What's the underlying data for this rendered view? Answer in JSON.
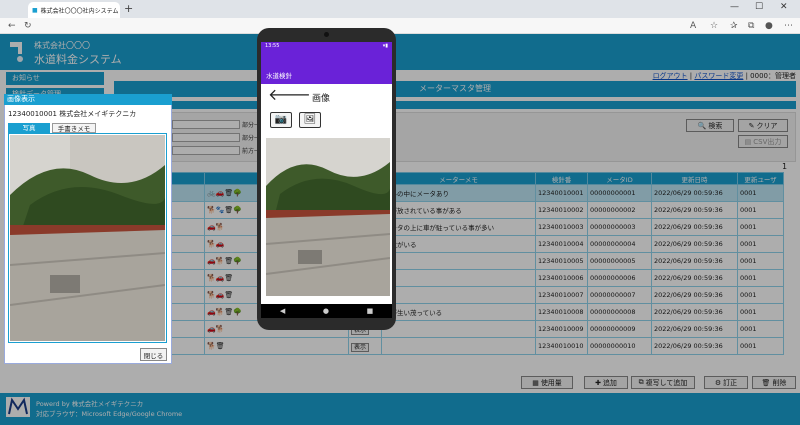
{
  "browser": {
    "tab_title": "株式会社〇〇〇社内システム / 水...",
    "new_tab": "+",
    "win_min": "—",
    "win_max": "☐",
    "win_close": "✕",
    "tab_close": "✕"
  },
  "header": {
    "company": "株式会社〇〇〇",
    "system": "水道料金システム"
  },
  "userbar": {
    "logout": "ログアウト",
    "sep": " | ",
    "change_password": "パスワード変更",
    "user": " | 0000：管理者"
  },
  "sidebar": {
    "items": [
      {
        "label": "お知らせ"
      },
      {
        "label": "検針データ管理"
      }
    ]
  },
  "page": {
    "title": "メーターマスタ管理",
    "search_label": "検索",
    "clear_label": "クリア",
    "csv_label": "CSV出力",
    "page_number": "1",
    "filters": [
      {
        "label": "部分一致"
      },
      {
        "label": "部分一致"
      },
      {
        "label": "前方一致"
      }
    ]
  },
  "table": {
    "headers": [
      "",
      "",
      "",
      "メーターメモ",
      "検針番",
      "メータID",
      "更新日時",
      "更新ユーザ"
    ],
    "rows": [
      {
        "memo": "茂みの中にメータあり",
        "kenshin": "12340010001",
        "meter": "00000000001",
        "date": "2022/06/29 00:59:36",
        "user": "0001",
        "selected": true
      },
      {
        "memo": "犬が放されている事がある",
        "kenshin": "12340010002",
        "meter": "00000000002",
        "date": "2022/06/29 00:59:36",
        "user": "0001"
      },
      {
        "memo": "メータの上に車が駐っている事が多い",
        "kenshin": "12340010003",
        "meter": "00000000003",
        "date": "2022/06/29 00:59:36",
        "user": "0001"
      },
      {
        "memo": "猛犬がいる",
        "kenshin": "12340010004",
        "meter": "00000000004",
        "date": "2022/06/29 00:59:36",
        "user": "0001"
      },
      {
        "memo": "",
        "kenshin": "12340010005",
        "meter": "00000000005",
        "date": "2022/06/29 00:59:36",
        "user": "0001"
      },
      {
        "memo": "",
        "kenshin": "12340010006",
        "meter": "00000000006",
        "date": "2022/06/29 00:59:36",
        "user": "0001"
      },
      {
        "memo": "",
        "kenshin": "12340010007",
        "meter": "00000000007",
        "date": "2022/06/29 00:59:36",
        "user": "0001"
      },
      {
        "memo": "草が生い茂っている",
        "kenshin": "12340010008",
        "meter": "00000000008",
        "date": "2022/06/29 00:59:36",
        "user": "0001"
      },
      {
        "memo": "",
        "kenshin": "12340010009",
        "meter": "00000000009",
        "date": "2022/06/29 00:59:36",
        "user": "0001"
      },
      {
        "memo": "",
        "kenshin": "12340010010",
        "meter": "00000000010",
        "date": "2022/06/29 00:59:36",
        "user": "0001"
      }
    ],
    "show_label": "表示"
  },
  "actions": {
    "usage": "使用量",
    "add": "追加",
    "copy_add": "複写して追加",
    "edit": "訂正",
    "delete": "削除"
  },
  "footer": {
    "powered": "Powerd by 株式会社メイギテクニカ",
    "browsers": "対応ブラウザ：Microsoft Edge/Google Chrome"
  },
  "popup": {
    "title": "画像表示",
    "name": "12340010001 株式会社メイギテクニカ",
    "tab_photo": "写真",
    "tab_memo": "手書きメモ",
    "close": "閉じる"
  },
  "phone": {
    "time": "13:55",
    "app_title": "水道検針",
    "screen_title": "画像",
    "back": "🡐"
  },
  "colors": {
    "accent": "#1a9fd0",
    "phone_accent": "#6a22d8"
  }
}
